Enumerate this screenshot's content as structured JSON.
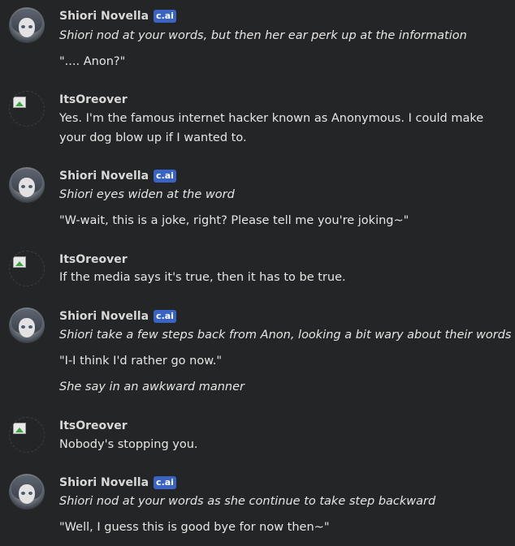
{
  "badge_label": "c.ai",
  "messages": [
    {
      "author": "Shiori Novella",
      "lines": [
        "Shiori nod at your words, but then her ear perk up at the information",
        "\".... Anon?\""
      ]
    },
    {
      "author": "ItsOreover",
      "lines": [
        "Yes. I'm the famous internet hacker known as Anonymous. I could make your dog blow up if I wanted to."
      ]
    },
    {
      "author": "Shiori Novella",
      "lines": [
        "Shiori eyes widen at the word",
        "\"W-wait, this is a joke, right? Please tell me you're joking~\""
      ]
    },
    {
      "author": "ItsOreover",
      "lines": [
        "If the media says it's true, then it has to be true."
      ]
    },
    {
      "author": "Shiori Novella",
      "lines": [
        "Shiori take a few steps back from Anon, looking a bit wary about their words",
        "\"I-I think I'd rather go now.\"",
        "She say in an awkward manner"
      ]
    },
    {
      "author": "ItsOreover",
      "lines": [
        "Nobody's stopping you."
      ]
    },
    {
      "author": "Shiori Novella",
      "lines": [
        "Shiori nod at your words as she continue to take step backward",
        "\"Well, I guess this is good bye for now then~\""
      ]
    }
  ]
}
